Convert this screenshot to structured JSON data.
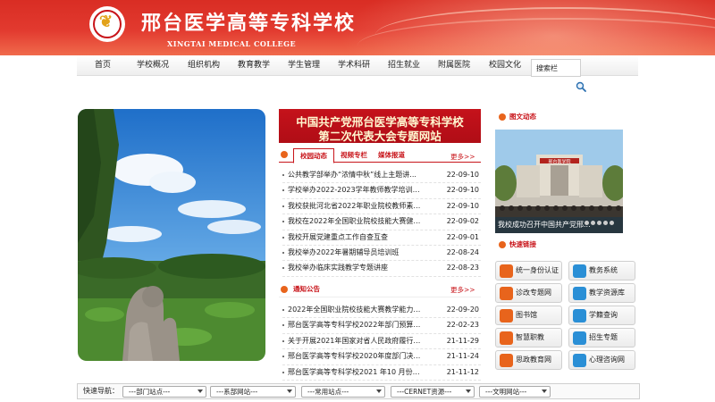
{
  "header": {
    "school_name_cn": "邢台医学高等专科学校",
    "school_name_en": "XINGTAI MEDICAL COLLEGE"
  },
  "nav": {
    "items": [
      "首页",
      "学校概况",
      "组织机构",
      "教育教学",
      "学生管理",
      "学术科研",
      "招生就业",
      "附属医院",
      "校园文化"
    ],
    "search_placeholder": "搜索栏"
  },
  "special_topic": {
    "line1": "中国共产党邢台医学高等专科学校",
    "line2": "第二次代表大会专题网站"
  },
  "news": {
    "tabs": [
      "校园动态",
      "视频专栏",
      "媒体报道"
    ],
    "active_tab": 0,
    "more_label": "更多>>",
    "items": [
      {
        "title": "公共教学部举办“浓情中秋”线上主题讲...",
        "date": "22-09-10"
      },
      {
        "title": "学校举办2022-2023学年教师教学培训活动",
        "date": "22-09-10"
      },
      {
        "title": "我校获批河北省2022年职业院校教师素质...",
        "date": "22-09-10"
      },
      {
        "title": "我校在2022年全国职业院校技能大赛健康...",
        "date": "22-09-02"
      },
      {
        "title": "我校开展党建重点工作自查互查",
        "date": "22-09-01"
      },
      {
        "title": "我校举办2022年暑期辅导员培训班",
        "date": "22-08-24"
      },
      {
        "title": "我校举办临床实践教学专题讲座",
        "date": "22-08-23"
      }
    ]
  },
  "notices": {
    "title": "通知公告",
    "more_label": "更多>>",
    "items": [
      {
        "title": "2022年全国职业院校技能大赛教学能力比...",
        "date": "22-09-20"
      },
      {
        "title": "邢台医学高等专科学校2022年部门预算公...",
        "date": "22-02-23"
      },
      {
        "title": "关于开展2021年国家对省人民政府履行教...",
        "date": "21-11-29"
      },
      {
        "title": "邢台医学高等专科学校2020年度部门决算...",
        "date": "21-11-24"
      },
      {
        "title": "邢台医学高等专科学校2021 年10 月份预...",
        "date": "21-11-12"
      }
    ]
  },
  "sidebar": {
    "gallery_title": "图文动态",
    "gallery_caption": "我校成功召开中国共产党邢...",
    "building_sign": "邢台医学院",
    "quick_links_title": "快速链接",
    "quick_links": [
      {
        "label": "统一身份认证",
        "icon": "id-card-icon",
        "color": "#e8641c"
      },
      {
        "label": "教务系统",
        "icon": "academic-system-icon",
        "color": "#2a8fd6"
      },
      {
        "label": "诊改专题网",
        "icon": "diagnosis-reform-icon",
        "color": "#e8641c"
      },
      {
        "label": "教学资源库",
        "icon": "teaching-resource-icon",
        "color": "#2a8fd6"
      },
      {
        "label": "图书馆",
        "icon": "library-icon",
        "color": "#e8641c"
      },
      {
        "label": "学籍查询",
        "icon": "student-record-icon",
        "color": "#2a8fd6"
      },
      {
        "label": "智慧职教",
        "icon": "smart-education-icon",
        "color": "#e8641c"
      },
      {
        "label": "招生专题",
        "icon": "admissions-icon",
        "color": "#2a8fd6"
      },
      {
        "label": "思政教育网",
        "icon": "ideology-education-icon",
        "color": "#e8641c"
      },
      {
        "label": "心理咨询网",
        "icon": "psychology-consult-icon",
        "color": "#2a8fd6"
      }
    ]
  },
  "footer": {
    "label": "快速导航：",
    "selects": [
      "---部门站点---",
      "---系部网站---",
      "---常用站点---",
      "---CERNET资源---",
      "---文明网站---"
    ]
  },
  "colors": {
    "brand_red": "#c8141a",
    "accent_orange": "#e8641c",
    "link_blue": "#2a8fd6"
  }
}
